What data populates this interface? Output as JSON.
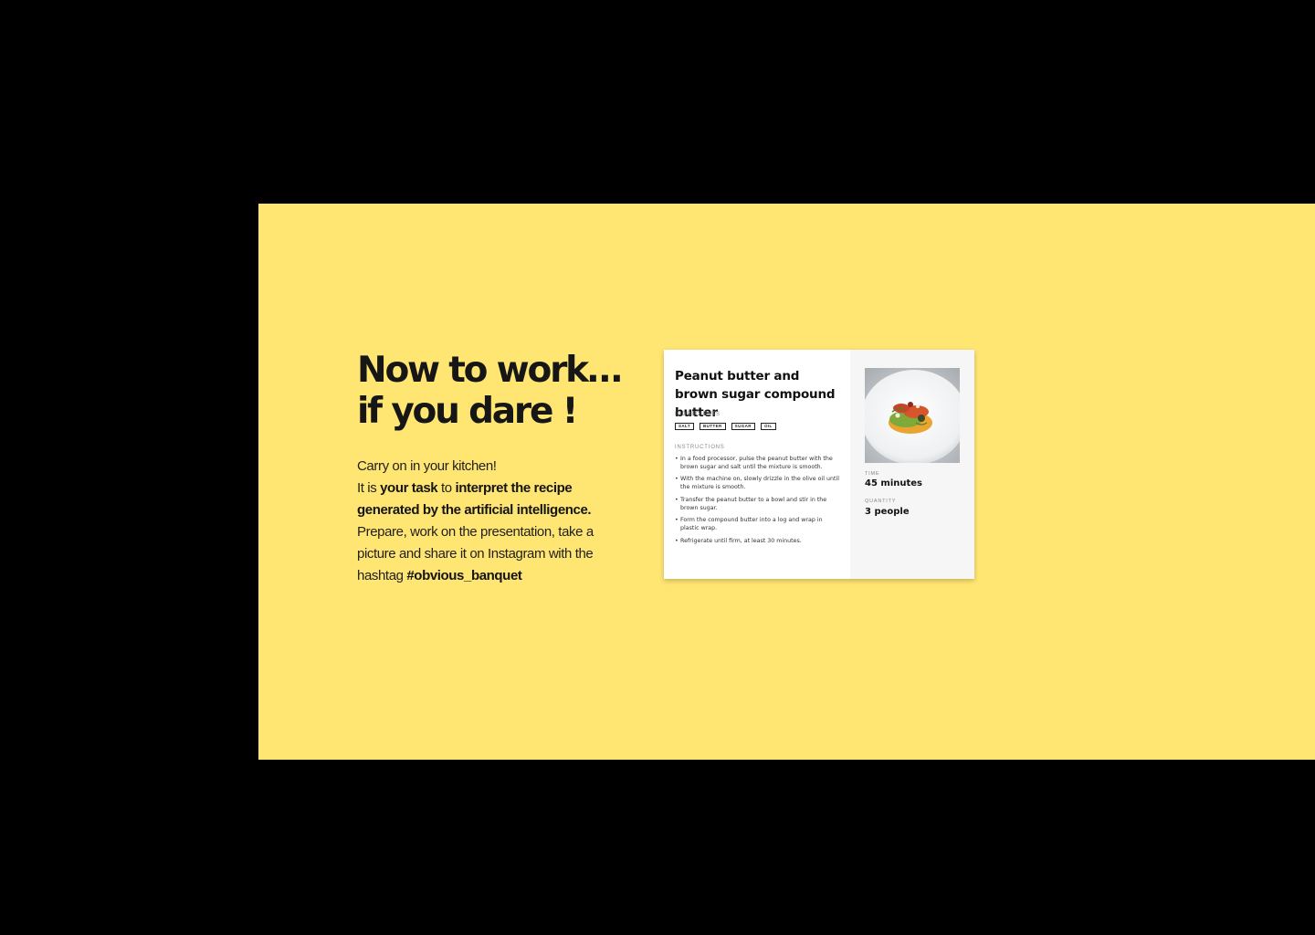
{
  "hero": {
    "heading_line1": "Now to work…",
    "heading_line2": "if you dare !",
    "intro": {
      "line1": "Carry on in your kitchen!",
      "line2_pre": "It is ",
      "line2_bold1": "your task",
      "line2_mid": " to ",
      "line2_bold2": "interpret the recipe",
      "line3_bold": "generated by the artificial intelligence.",
      "line4": "Prepare, work on the presentation, take a",
      "line5": "picture and share it on Instagram with the",
      "line6_pre": "hashtag ",
      "line6_bold": "#obvious_banquet"
    }
  },
  "recipe": {
    "title": "Peanut butter and brown sugar compound butter",
    "ingredients_label": "INGREDIENTS",
    "ingredients": [
      "SALT",
      "BUTTER",
      "SUGAR",
      "OIL"
    ],
    "instructions_label": "INSTRUCTIONS",
    "instructions": [
      "In a food processor, pulse the peanut butter with the brown sugar and salt until the mixture is smooth.",
      "With the machine on, slowly drizzle in the olive oil until the mixture is smooth.",
      "Transfer the peanut butter to a bowl and stir in the brown sugar.",
      "Form the compound butter into a log and wrap in plastic wrap.",
      "Refrigerate until firm, at least 30 minutes."
    ],
    "time_label": "TIME",
    "time_value": "45 minutes",
    "quantity_label": "QUANTITY",
    "quantity_value": "3 people",
    "image_icon": "plated-dish-photo"
  },
  "colors": {
    "background": "#000000",
    "panel": "#ffe571",
    "card": "#ffffff",
    "card_side": "#f6f6f6",
    "text_dark": "#161616"
  }
}
